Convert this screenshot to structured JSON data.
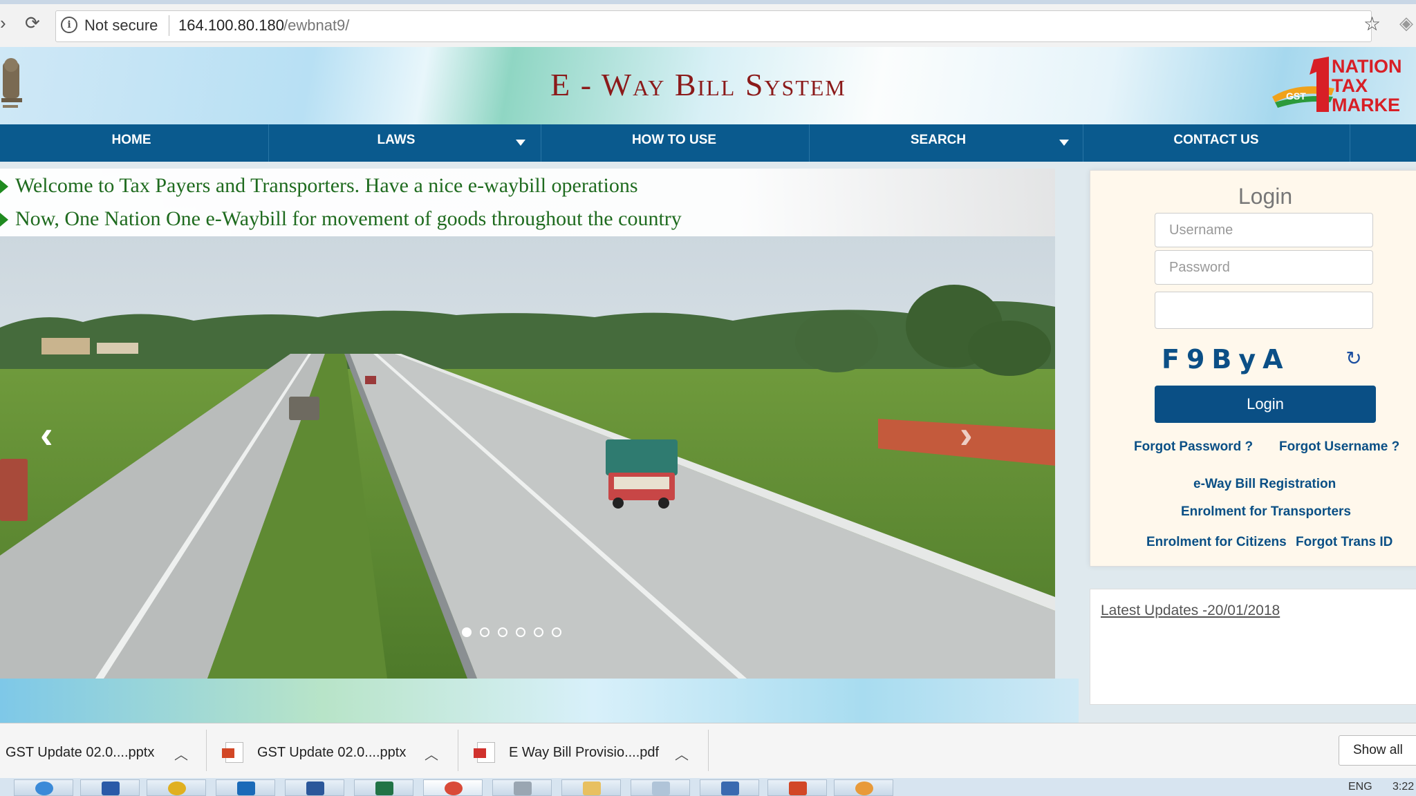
{
  "browser": {
    "security_label": "Not secure",
    "url_host": "164.100.80.180",
    "url_path": "/ewbnat9/"
  },
  "header": {
    "title": "E - Way Bill System",
    "logo_text": [
      "NATION",
      "TAX",
      "MARKE"
    ]
  },
  "nav": {
    "items": [
      {
        "label": "HOME"
      },
      {
        "label": "LAWS"
      },
      {
        "label": "HOW TO USE"
      },
      {
        "label": "SEARCH"
      },
      {
        "label": "CONTACT US"
      }
    ]
  },
  "ticker": {
    "lines": [
      "Welcome to Tax Payers and Transporters. Have a nice e-waybill operations",
      "Now, One Nation One e-Waybill for movement of goods throughout the country"
    ]
  },
  "slider": {
    "slide_count": 6,
    "active_index": 0
  },
  "login": {
    "title": "Login",
    "username_placeholder": "Username",
    "password_placeholder": "Password",
    "captcha_input_value": "",
    "captcha_text": "F9ByA",
    "button_label": "Login",
    "links": {
      "forgot_password": "Forgot Password ?",
      "forgot_username": "Forgot Username ?",
      "registration": "e-Way Bill Registration",
      "enrol_transporters": "Enrolment for Transporters",
      "enrol_citizens": "Enrolment for Citizens",
      "forgot_trans_id": "Forgot Trans ID"
    }
  },
  "updates": {
    "link_label": "Latest Updates -20/01/2018"
  },
  "downloads": {
    "items": [
      {
        "name": "GST Update  02.0....pptx"
      },
      {
        "name": "GST Update  02.0....pptx"
      },
      {
        "name": "E Way Bill Provisio....pdf"
      }
    ],
    "show_all_label": "Show all"
  },
  "taskbar": {
    "language": "ENG",
    "clock": "3:22"
  },
  "colors": {
    "nav_bg": "#0a5a8e",
    "title_red": "#8b1a1a",
    "ticker_green": "#1f6b1f",
    "login_button": "#0a4f85",
    "link_blue": "#0a4f85"
  }
}
